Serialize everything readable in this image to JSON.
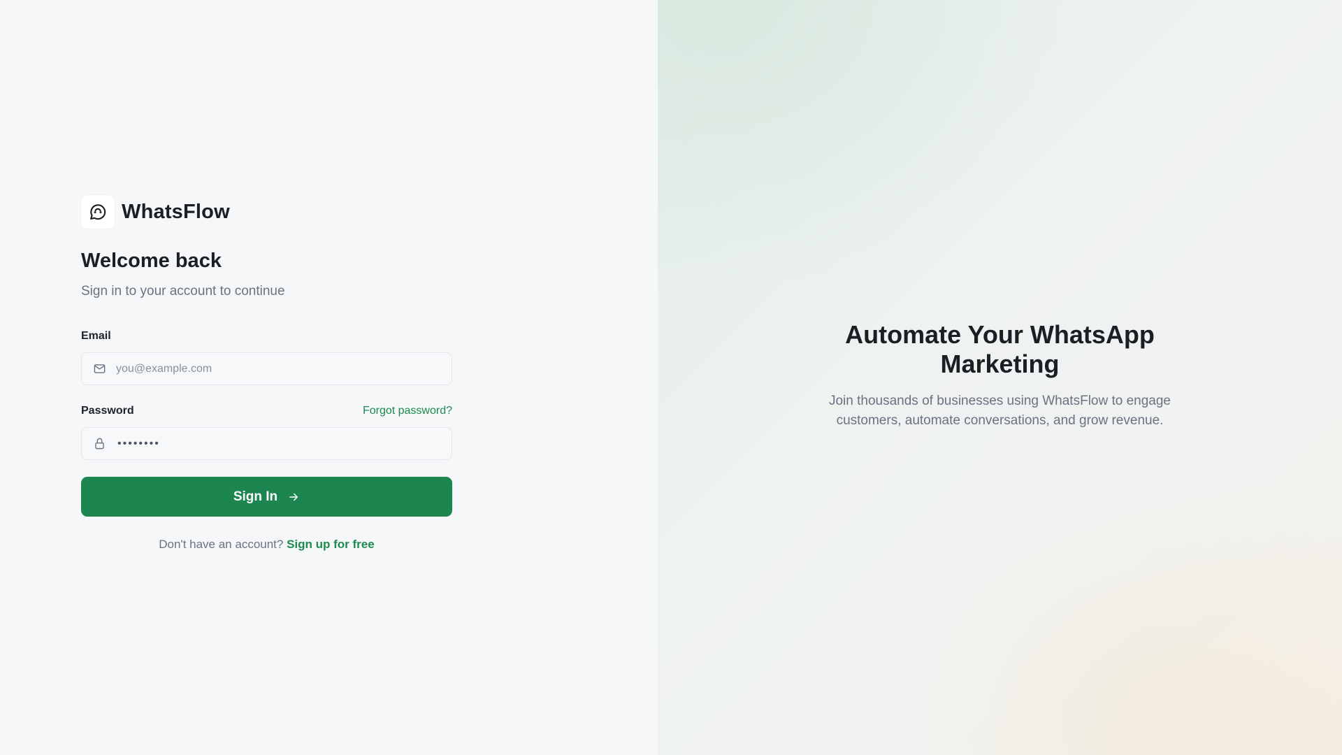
{
  "brand": {
    "name": "WhatsFlow",
    "logo_icon": "chat-bubble-icon"
  },
  "login": {
    "title": "Welcome back",
    "subtitle": "Sign in to your account to continue",
    "email": {
      "label": "Email",
      "placeholder": "you@example.com",
      "icon": "mail-icon",
      "value": ""
    },
    "password": {
      "label": "Password",
      "value_masked": "••••••••",
      "icon": "lock-icon",
      "forgot_label": "Forgot password?"
    },
    "submit_label": "Sign In",
    "signup_prompt": "Don't have an account?",
    "signup_link": "Sign up for free"
  },
  "hero": {
    "title": "Automate Your WhatsApp Marketing",
    "text": "Join thousands of businesses using WhatsFlow to engage customers, automate conversations, and grow revenue."
  },
  "colors": {
    "accent": "#1d8650",
    "link": "#1f8a4d",
    "background": "#f5f7f9"
  }
}
